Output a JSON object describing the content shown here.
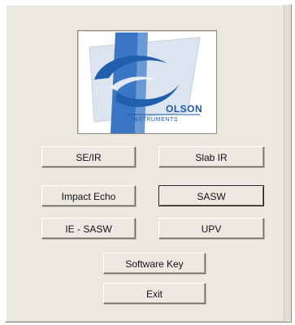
{
  "logo": {
    "brand": "OLSON",
    "subtitle": "INSTRUMENTS"
  },
  "buttons": {
    "se_ir": "SE/IR",
    "slab_ir": "Slab IR",
    "impact_echo": "Impact Echo",
    "sasw": "SASW",
    "ie_sasw": "IE - SASW",
    "upv": "UPV",
    "software_key": "Software Key",
    "exit": "Exit"
  },
  "colors": {
    "window_bg": "#ebe8e0",
    "brand_blue": "#1a5aa8",
    "logo_band": "#3a76c4"
  },
  "focused_button": "sasw"
}
